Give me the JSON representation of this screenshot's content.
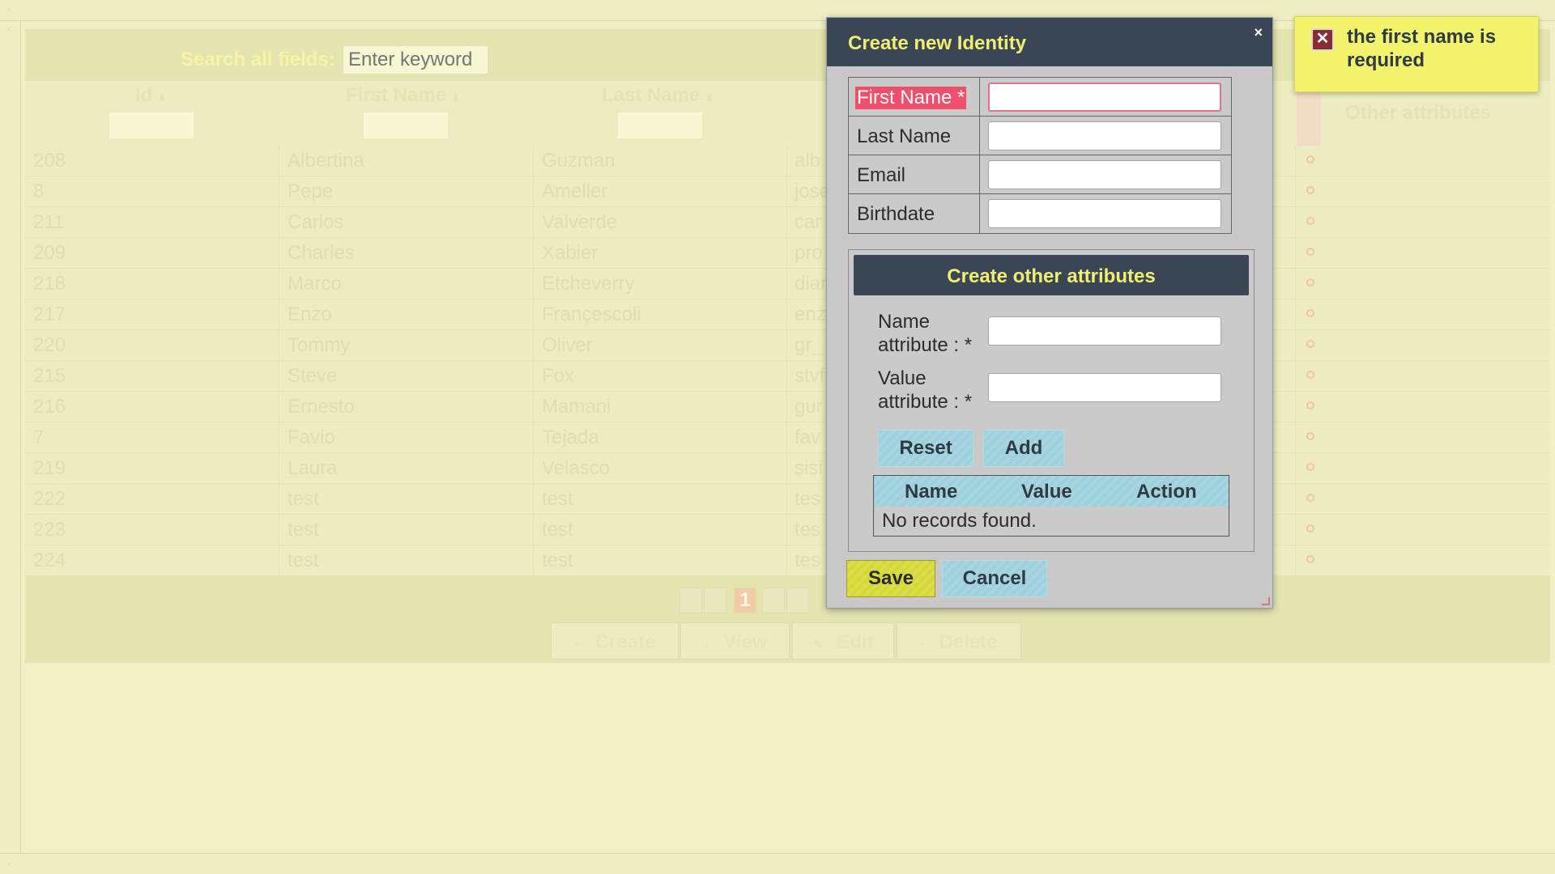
{
  "background": {
    "search_label": "Search all fields:",
    "search_placeholder": "Enter keyword",
    "columns": [
      "Id",
      "First Name",
      "Last Name"
    ],
    "other_attributes_header": "Other attributes",
    "rows": [
      {
        "id": "208",
        "first": "Albertina",
        "last": "Guzman",
        "email": "alb"
      },
      {
        "id": "8",
        "first": "Pepe",
        "last": "Ameller",
        "email": "jose"
      },
      {
        "id": "211",
        "first": "Carlos",
        "last": "Valverde",
        "email": "car"
      },
      {
        "id": "209",
        "first": "Charles",
        "last": "Xabier",
        "email": "pro"
      },
      {
        "id": "218",
        "first": "Marco",
        "last": "Etcheverry",
        "email": "diar"
      },
      {
        "id": "217",
        "first": "Enzo",
        "last": "Françescoli",
        "email": "enz"
      },
      {
        "id": "220",
        "first": "Tommy",
        "last": "Oliver",
        "email": "gr_"
      },
      {
        "id": "215",
        "first": "Steve",
        "last": "Fox",
        "email": "stvf"
      },
      {
        "id": "216",
        "first": "Ernesto",
        "last": "Mamani",
        "email": "gur"
      },
      {
        "id": "7",
        "first": "Favio",
        "last": "Tejada",
        "email": "fav"
      },
      {
        "id": "219",
        "first": "Laura",
        "last": "Velasco",
        "email": "sisi"
      },
      {
        "id": "222",
        "first": "test",
        "last": "test",
        "email": "tes"
      },
      {
        "id": "223",
        "first": "test",
        "last": "test",
        "email": "tes"
      },
      {
        "id": "224",
        "first": "test",
        "last": "test",
        "email": "tes"
      }
    ],
    "current_page": "1",
    "actions": [
      "Create",
      "View",
      "Edit",
      "Delete"
    ]
  },
  "dialog": {
    "title": "Create new Identity",
    "close": "×",
    "fields": [
      {
        "label": "First Name *",
        "value": "",
        "error": true
      },
      {
        "label": "Last Name",
        "value": "",
        "error": false
      },
      {
        "label": "Email",
        "value": "",
        "error": false
      },
      {
        "label": "Birthdate",
        "value": "",
        "error": false
      }
    ],
    "attributes": {
      "title": "Create other attributes",
      "name_label_line1": "Name",
      "name_label_line2": "attribute : *",
      "value_label_line1": "Value",
      "value_label_line2": "attribute : *",
      "reset": "Reset",
      "add": "Add",
      "table_headers": [
        "Name",
        "Value",
        "Action"
      ],
      "empty_message": "No records found."
    },
    "save": "Save",
    "cancel": "Cancel"
  },
  "notification": {
    "message": "the first name is required",
    "icon": "error-x-icon"
  },
  "colors": {
    "dialog_header": "#3a4556",
    "title_text": "#f1f06e",
    "notification_bg": "#f3f36c",
    "error_label": "#ef4f6a",
    "save_button": "#d5d83a",
    "secondary_button": "#9fd0dc"
  }
}
